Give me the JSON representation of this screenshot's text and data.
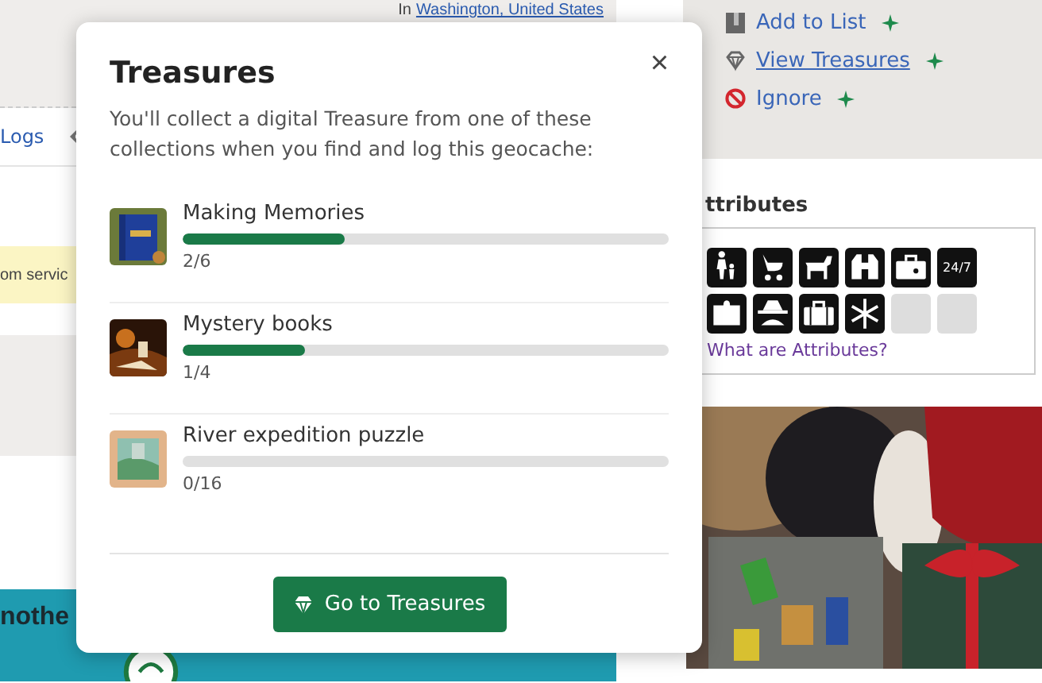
{
  "background": {
    "location": {
      "prefix": "In",
      "place": "Washington, United States"
    },
    "logs_link": "Logs",
    "notice": "om servic",
    "banner": "nothe"
  },
  "sidebar": {
    "actions": [
      {
        "kind": "list",
        "label": "Add to List",
        "hovered": false
      },
      {
        "kind": "treasures",
        "label": "View Treasures",
        "hovered": true
      },
      {
        "kind": "ignore",
        "label": "Ignore",
        "hovered": false
      }
    ],
    "attributes": {
      "heading": "ttributes",
      "icons": [
        {
          "kind": "family"
        },
        {
          "kind": "stroller"
        },
        {
          "kind": "dog"
        },
        {
          "kind": "binoculars"
        },
        {
          "kind": "toolbox"
        },
        {
          "kind": "text",
          "label": "24/7"
        },
        {
          "kind": "puzzle"
        },
        {
          "kind": "spy"
        },
        {
          "kind": "briefcase"
        },
        {
          "kind": "snowflake"
        },
        {
          "kind": "empty"
        },
        {
          "kind": "empty"
        }
      ],
      "help_link": "What are Attributes?"
    }
  },
  "modal": {
    "title": "Treasures",
    "close": "×",
    "description": "You'll collect a digital Treasure from one of these collections when you find and log this geocache:",
    "collections": [
      {
        "name": "Making Memories",
        "level": 0.333,
        "count": "2/6"
      },
      {
        "name": "Mystery books",
        "level": 0.25,
        "count": "1/4"
      },
      {
        "name": "River expedition puzzle",
        "level": 0,
        "count": "0/16"
      }
    ],
    "button": "Go to Treasures"
  }
}
